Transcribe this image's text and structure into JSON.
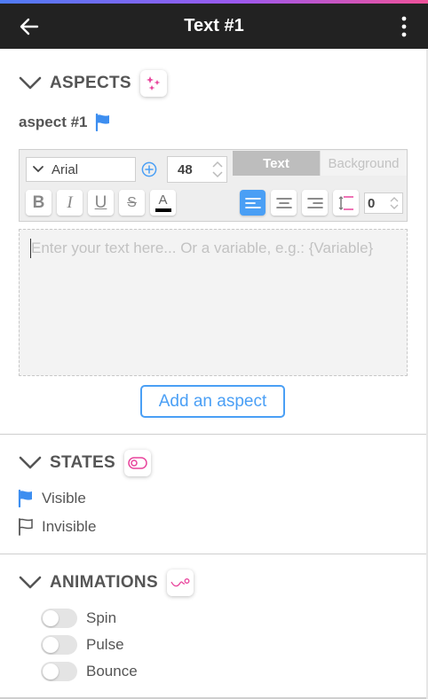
{
  "header": {
    "title": "Text #1",
    "back_icon": "arrow-left-icon",
    "menu_icon": "more-vertical-icon",
    "background": "#222222"
  },
  "accent": "#4a9ff5",
  "sections": {
    "aspects": {
      "label": "ASPECTS",
      "icon": "sparkles-icon",
      "aspect_name": "aspect #1",
      "font": "Arial",
      "font_size": "48",
      "tabs": [
        "Text",
        "Background"
      ],
      "active_tab": "Text",
      "format_buttons": {
        "bold": "B",
        "italic": "I",
        "underline": "U",
        "strike": "S",
        "color": "A"
      },
      "alignment": "left",
      "line_spacing": "0",
      "placeholder": "Enter your text here... Or a variable, e.g.: {Variable}",
      "add_button": "Add an aspect"
    },
    "states": {
      "label": "STATES",
      "icon": "toggle-icon",
      "items": [
        {
          "label": "Visible",
          "icon": "flag-filled-icon"
        },
        {
          "label": "Invisible",
          "icon": "flag-outline-icon"
        }
      ]
    },
    "animations": {
      "label": "ANIMATIONS",
      "icon": "motion-path-icon",
      "items": [
        {
          "label": "Spin",
          "enabled": false
        },
        {
          "label": "Pulse",
          "enabled": false
        },
        {
          "label": "Bounce",
          "enabled": false
        }
      ]
    }
  }
}
